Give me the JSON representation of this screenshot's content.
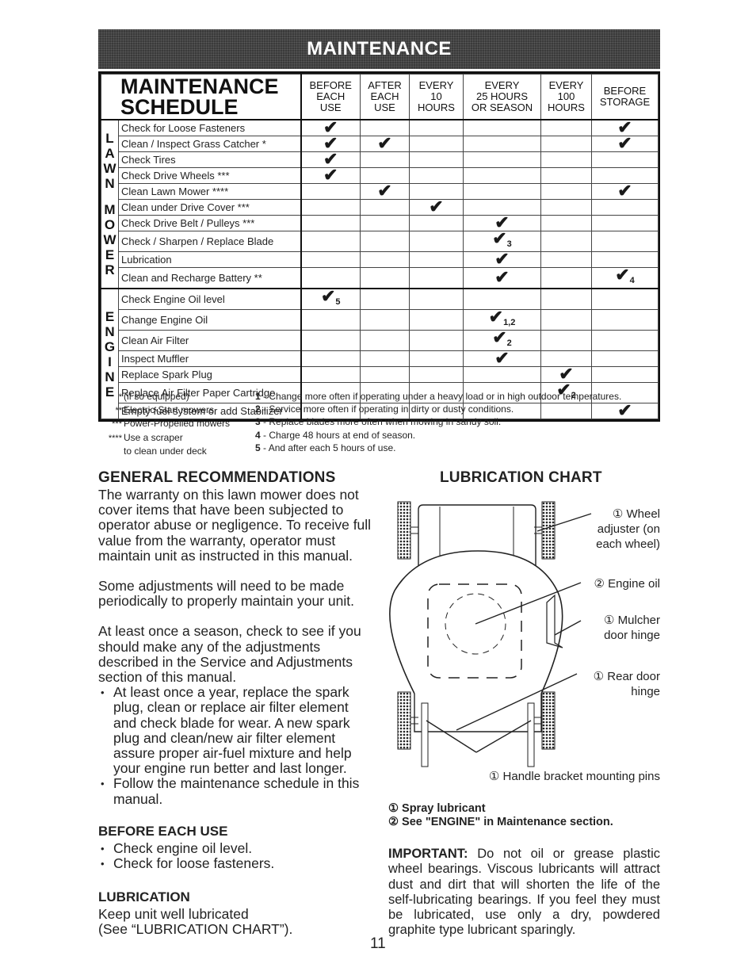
{
  "banner": {
    "title": "MAINTENANCE"
  },
  "schedule": {
    "title_line1": "MAINTENANCE",
    "title_line2": "SCHEDULE",
    "columns": [
      [
        "BEFORE",
        "EACH",
        "USE"
      ],
      [
        "AFTER",
        "EACH",
        "USE"
      ],
      [
        "EVERY",
        "10",
        "HOURS"
      ],
      [
        "EVERY",
        "25 HOURS",
        "OR SEASON"
      ],
      [
        "EVERY",
        "100",
        "HOURS"
      ],
      [
        "BEFORE",
        "STORAGE"
      ]
    ],
    "check_glyph": "✔",
    "groups": [
      {
        "side_label": "LAWN MOWER",
        "rows": [
          {
            "task": "Check for Loose Fasteners",
            "marks": [
              "✔",
              "",
              "",
              "",
              "",
              "✔"
            ],
            "notes": [
              "",
              "",
              "",
              "",
              "",
              ""
            ]
          },
          {
            "task": "Clean / Inspect Grass Catcher *",
            "marks": [
              "✔",
              "✔",
              "",
              "",
              "",
              "✔"
            ],
            "notes": [
              "",
              "",
              "",
              "",
              "",
              ""
            ]
          },
          {
            "task": "Check Tires",
            "marks": [
              "✔",
              "",
              "",
              "",
              "",
              ""
            ],
            "notes": [
              "",
              "",
              "",
              "",
              "",
              ""
            ]
          },
          {
            "task": "Check Drive Wheels ***",
            "marks": [
              "✔",
              "",
              "",
              "",
              "",
              ""
            ],
            "notes": [
              "",
              "",
              "",
              "",
              "",
              ""
            ]
          },
          {
            "task": "Clean Lawn Mower ****",
            "marks": [
              "",
              "✔",
              "",
              "",
              "",
              "✔"
            ],
            "notes": [
              "",
              "",
              "",
              "",
              "",
              ""
            ]
          },
          {
            "task": "Clean under Drive Cover ***",
            "marks": [
              "",
              "",
              "✔",
              "",
              "",
              ""
            ],
            "notes": [
              "",
              "",
              "",
              "",
              "",
              ""
            ]
          },
          {
            "task": "Check Drive Belt / Pulleys ***",
            "marks": [
              "",
              "",
              "",
              "✔",
              "",
              ""
            ],
            "notes": [
              "",
              "",
              "",
              "",
              "",
              ""
            ]
          },
          {
            "task": "Check / Sharpen / Replace Blade",
            "marks": [
              "",
              "",
              "",
              "✔",
              "",
              ""
            ],
            "notes": [
              "",
              "",
              "",
              "3",
              "",
              ""
            ]
          },
          {
            "task": "Lubrication",
            "marks": [
              "",
              "",
              "",
              "✔",
              "",
              ""
            ],
            "notes": [
              "",
              "",
              "",
              "",
              "",
              ""
            ]
          },
          {
            "task": "Clean and Recharge Battery **",
            "marks": [
              "",
              "",
              "",
              "✔",
              "",
              "✔"
            ],
            "notes": [
              "",
              "",
              "",
              "",
              "",
              "4"
            ]
          }
        ]
      },
      {
        "side_label": "ENGINE",
        "rows": [
          {
            "task": "Check Engine Oil level",
            "marks": [
              "✔",
              "",
              "",
              "",
              "",
              ""
            ],
            "notes": [
              "5",
              "",
              "",
              "",
              "",
              ""
            ]
          },
          {
            "task": "Change Engine Oil",
            "marks": [
              "",
              "",
              "",
              "✔",
              "",
              ""
            ],
            "notes": [
              "",
              "",
              "",
              "1,2",
              "",
              ""
            ]
          },
          {
            "task": "Clean Air Filter",
            "marks": [
              "",
              "",
              "",
              "✔",
              "",
              ""
            ],
            "notes": [
              "",
              "",
              "",
              "2",
              "",
              ""
            ]
          },
          {
            "task": "Inspect Muffler",
            "marks": [
              "",
              "",
              "",
              "✔",
              "",
              ""
            ],
            "notes": [
              "",
              "",
              "",
              "",
              "",
              ""
            ]
          },
          {
            "task": "Replace Spark Plug",
            "marks": [
              "",
              "",
              "",
              "",
              "✔",
              ""
            ],
            "notes": [
              "",
              "",
              "",
              "",
              "",
              ""
            ]
          },
          {
            "task": "Replace Air Filter Paper Cartridge",
            "marks": [
              "",
              "",
              "",
              "",
              "✔",
              ""
            ],
            "notes": [
              "",
              "",
              "",
              "",
              "2",
              ""
            ]
          },
          {
            "task": "Empty fuel system or add Stabilizer",
            "marks": [
              "",
              "",
              "",
              "",
              "",
              "✔"
            ],
            "notes": [
              "",
              "",
              "",
              "",
              "",
              ""
            ]
          }
        ]
      }
    ]
  },
  "footnotes_symbols": [
    {
      "mark": "*",
      "text": "(if so equipped)"
    },
    {
      "mark": "**",
      "text": "Electric-Start mowers"
    },
    {
      "mark": "***",
      "text": "Power-Propelled mowers"
    },
    {
      "mark": "****",
      "text": "Use a scraper"
    },
    {
      "mark": "",
      "text": "to clean under deck"
    }
  ],
  "footnotes_numbers": [
    {
      "num": "1",
      "text": " - Change more often if operating under a heavy load or in high outdoor temperatures."
    },
    {
      "num": "2",
      "text": " - Service more often if operating in dirty or dusty conditions."
    },
    {
      "num": "3",
      "text": " - Replace blades more often when mowing in sandy soil."
    },
    {
      "num": "4",
      "text": " - Charge 48 hours at end of season."
    },
    {
      "num": "5",
      "text": " - And after each 5 hours of use."
    }
  ],
  "general": {
    "heading": "GENERAL RECOMMENDATIONS",
    "para1": "The warranty on this lawn mower does not cover items that have been subjected to operator abuse or negligence.  To receive full value from the warranty, operator must maintain unit as instructed in this manual.",
    "para2": "Some adjustments will need to be made periodically to properly maintain your unit.",
    "para3": "At least once a season, check to see if you should make any of the adjustments described in the Service and Adjustments section of this manual.",
    "bullets": [
      "At least once a year, replace the spark plug, clean or replace air filter element and check blade for wear.  A new spark plug and clean/new air filter element assure proper air-fuel mixture and help your engine run better and last longer.",
      "Follow the maintenance schedule in this manual."
    ]
  },
  "before_each_use": {
    "heading": "BEFORE EACH USE",
    "bullets": [
      "Check engine oil level.",
      "Check for loose fasteners."
    ]
  },
  "lubrication": {
    "heading": "LUBRICATION",
    "line1": "Keep unit well lubricated",
    "line2": "(See “LUBRICATION CHART”)."
  },
  "lubrication_chart": {
    "heading": "LUBRICATION CHART",
    "callouts": {
      "wheel_adjuster": "① Wheel adjuster (on each wheel)",
      "engine_oil": "② Engine oil",
      "mulcher_door": "① Mulcher door hinge",
      "rear_door": "① Rear door hinge",
      "handle_pins": "① Handle bracket mounting pins"
    },
    "legend": [
      "① Spray lubricant",
      "② See \"ENGINE\" in Maintenance section."
    ]
  },
  "important": {
    "label": "IMPORTANT:",
    "text": "  Do not oil or grease plastic wheel bearings.  Viscous lubricants will attract dust and dirt that will shorten the life of the self-lubricating bearings.  If you feel they must be lubricated, use only a dry, powdered graphite type lubricant sparingly."
  },
  "page_number": "11"
}
